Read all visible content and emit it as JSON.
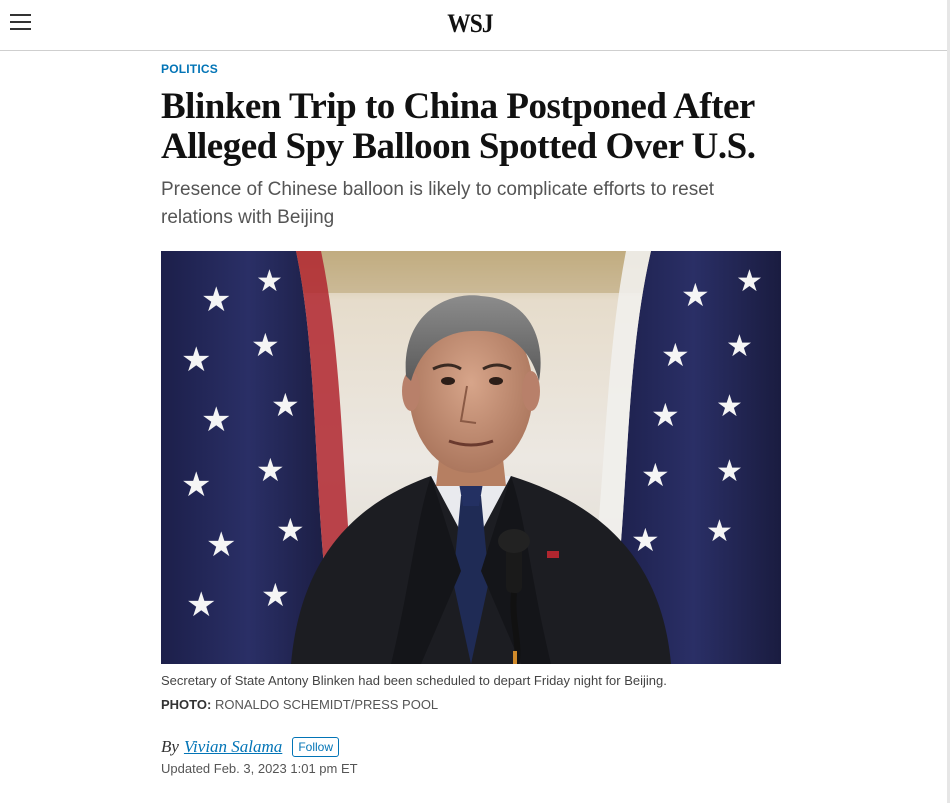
{
  "header": {
    "menu_icon": "hamburger-menu-icon",
    "logo_text": "WSJ"
  },
  "article": {
    "section": "POLITICS",
    "headline": "Blinken Trip to China Postponed After Alleged Spy Balloon Spotted Over U.S.",
    "dek": "Presence of Chinese balloon is likely to complicate efforts to reset relations with Beijing",
    "photo": {
      "caption": "Secretary of State Antony Blinken had been scheduled to depart Friday night for Beijing.",
      "credit_label": "PHOTO:",
      "credit_value": "RONALDO SCHEMIDT/PRESS POOL"
    },
    "byline": {
      "prefix": "By",
      "author": "Vivian Salama",
      "follow_label": "Follow"
    },
    "timestamp": "Updated Feb. 3, 2023 1:01 pm ET"
  },
  "colors": {
    "accent": "#0274b6",
    "text": "#111111",
    "dek": "#555555"
  }
}
